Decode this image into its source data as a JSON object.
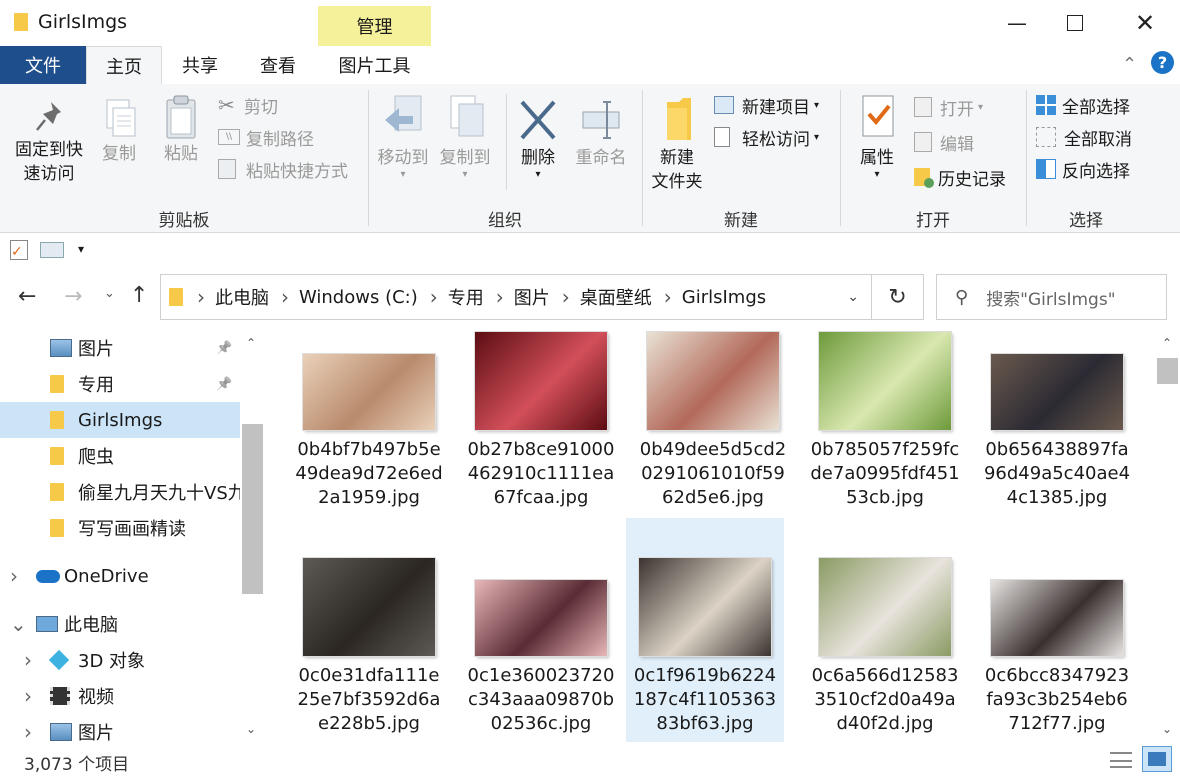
{
  "window": {
    "title": "GirlsImgs",
    "manage_label": "管理"
  },
  "tabs": {
    "file": "文件",
    "home": "主页",
    "share": "共享",
    "view": "查看",
    "picture_tools": "图片工具"
  },
  "ribbon": {
    "clipboard": {
      "pin": "固定到快\n速访问",
      "copy": "复制",
      "paste": "粘贴",
      "cut": "剪切",
      "copy_path": "复制路径",
      "paste_shortcut": "粘贴快捷方式",
      "label": "剪贴板"
    },
    "organize": {
      "move_to": "移动到",
      "copy_to": "复制到",
      "delete": "删除",
      "rename": "重命名",
      "label": "组织"
    },
    "new": {
      "new_folder": "新建\n文件夹",
      "new_item": "新建项目",
      "easy_access": "轻松访问",
      "label": "新建"
    },
    "open": {
      "properties": "属性",
      "open": "打开",
      "edit": "编辑",
      "history": "历史记录",
      "label": "打开"
    },
    "select": {
      "select_all": "全部选择",
      "select_none": "全部取消",
      "invert": "反向选择",
      "label": "选择"
    }
  },
  "address": {
    "crumbs": [
      "此电脑",
      "Windows (C:)",
      "专用",
      "图片",
      "桌面壁纸",
      "GirlsImgs"
    ],
    "search_placeholder": "搜索\"GirlsImgs\""
  },
  "nav": {
    "items": [
      {
        "label": "图片",
        "pinned": true
      },
      {
        "label": "专用",
        "pinned": true
      },
      {
        "label": "GirlsImgs",
        "selected": true
      },
      {
        "label": "爬虫"
      },
      {
        "label": "偷星九月天九十VS九"
      },
      {
        "label": "写写画画精读"
      },
      {
        "label": "OneDrive"
      },
      {
        "label": "此电脑"
      },
      {
        "label": "3D 对象"
      },
      {
        "label": "视频"
      },
      {
        "label": "图片"
      }
    ]
  },
  "files": [
    {
      "name": "0b4bf7b497b5e49dea9d72e6ed2a1959.jpg",
      "colors": [
        "#e9d1b9",
        "#b98a6c"
      ]
    },
    {
      "name": "0b27b8ce91000462910c1111ea67fcaa.jpg",
      "colors": [
        "#5c0d12",
        "#d24f5a"
      ]
    },
    {
      "name": "0b49dee5d5cd20291061010f5962d5e6.jpg",
      "colors": [
        "#e9e2d4",
        "#b2695a"
      ]
    },
    {
      "name": "0b785057f259fcde7a0995fdf45153cb.jpg",
      "colors": [
        "#6d9a3b",
        "#d9e8b0"
      ]
    },
    {
      "name": "0b656438897fa96d49a5c40ae44c1385.jpg",
      "colors": [
        "#6b5a4e",
        "#2b2a33"
      ]
    },
    {
      "name": "0c0e31dfa111e25e7bf3592d6ae228b5.jpg",
      "colors": [
        "#5d5a55",
        "#2b2622"
      ]
    },
    {
      "name": "0c1e360023720c343aaa09870b02536c.jpg",
      "colors": [
        "#e7b7b8",
        "#5a2b34"
      ]
    },
    {
      "name": "0c1f9619b6224187c4f110536383bf63.jpg",
      "colors": [
        "#3b3430",
        "#dcd3c6"
      ],
      "selected": true
    },
    {
      "name": "0c6a566d125833510cf2d0a49ad40f2d.jpg",
      "colors": [
        "#8a9b63",
        "#e8e3dc"
      ]
    },
    {
      "name": "0c6bcc8347923fa93c3b254eb6712f77.jpg",
      "colors": [
        "#e7e4e2",
        "#3a3030"
      ]
    }
  ],
  "status": {
    "count": "3,073 个项目"
  },
  "colors": {
    "file_tab": "#1f4e8c",
    "accent": "#1a73c7",
    "selected": "#cce4f7",
    "manage": "#f5f19a"
  }
}
